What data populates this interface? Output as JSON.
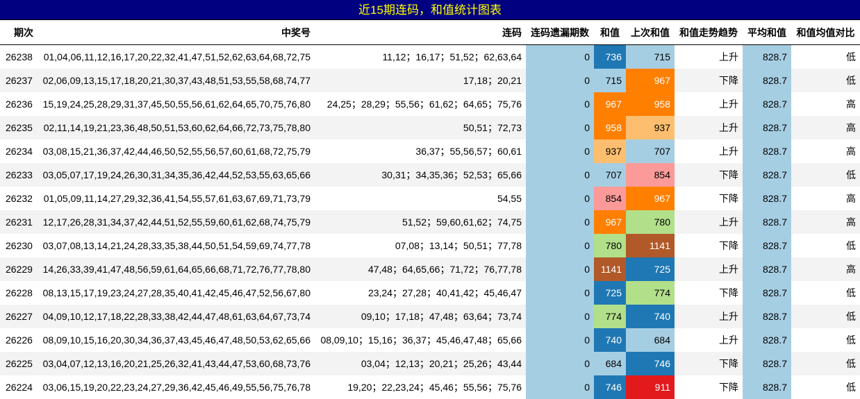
{
  "title": "近15期连码，和值统计图表",
  "headers": {
    "period": "期次",
    "nums": "中奖号",
    "lian": "连码",
    "miss": "连码遗漏期数",
    "sum": "和值",
    "prev_sum": "上次和值",
    "trend": "和值走势趋势",
    "avg": "平均和值",
    "cmp": "和值均值对比"
  },
  "colors": {
    "title_bg": "#010080",
    "title_text": "#ffff00",
    "sky": "#a6cee3",
    "blue": "#1f78b4",
    "lightblue": "#a6cee3",
    "orange": "#ff7f00",
    "lightorange": "#fdbf6f",
    "pink": "#fb9a99",
    "green": "#b2df8a",
    "brown": "#b15928",
    "red": "#e31a1c"
  },
  "rows": [
    {
      "period": "26238",
      "nums": "01,04,06,11,12,16,17,20,22,32,41,47,51,52,62,63,64,68,72,75",
      "lian": "11,12；16,17；51,52；62,63,64",
      "miss": "0",
      "sum": "736",
      "sum_color": "blue",
      "prev": "715",
      "prev_color": "lightblue",
      "trend": "上升",
      "avg": "828.7",
      "cmp": "低"
    },
    {
      "period": "26237",
      "nums": "02,06,09,13,15,17,18,20,21,30,37,43,48,51,53,55,58,68,74,77",
      "lian": "17,18；20,21",
      "miss": "0",
      "sum": "715",
      "sum_color": "lightblue",
      "prev": "967",
      "prev_color": "orange",
      "trend": "下降",
      "avg": "828.7",
      "cmp": "低"
    },
    {
      "period": "26236",
      "nums": "15,19,24,25,28,29,31,37,45,50,55,56,61,62,64,65,70,75,76,80",
      "lian": "24,25；28,29；55,56；61,62；64,65；75,76",
      "miss": "0",
      "sum": "967",
      "sum_color": "orange",
      "prev": "958",
      "prev_color": "orange",
      "trend": "上升",
      "avg": "828.7",
      "cmp": "高"
    },
    {
      "period": "26235",
      "nums": "02,11,14,19,21,23,36,48,50,51,53,60,62,64,66,72,73,75,78,80",
      "lian": "50,51；72,73",
      "miss": "0",
      "sum": "958",
      "sum_color": "orange",
      "prev": "937",
      "prev_color": "lightorange",
      "trend": "上升",
      "avg": "828.7",
      "cmp": "高"
    },
    {
      "period": "26234",
      "nums": "03,08,15,21,36,37,42,44,46,50,52,55,56,57,60,61,68,72,75,79",
      "lian": "36,37；55,56,57；60,61",
      "miss": "0",
      "sum": "937",
      "sum_color": "lightorange",
      "prev": "707",
      "prev_color": "lightblue",
      "trend": "上升",
      "avg": "828.7",
      "cmp": "高"
    },
    {
      "period": "26233",
      "nums": "03,05,07,17,19,24,26,30,31,34,35,36,42,44,52,53,55,63,65,66",
      "lian": "30,31；34,35,36；52,53；65,66",
      "miss": "0",
      "sum": "707",
      "sum_color": "lightblue",
      "prev": "854",
      "prev_color": "pink",
      "trend": "下降",
      "avg": "828.7",
      "cmp": "低"
    },
    {
      "period": "26232",
      "nums": "01,05,09,11,14,27,29,32,36,41,54,55,57,61,63,67,69,71,73,79",
      "lian": "54,55",
      "miss": "0",
      "sum": "854",
      "sum_color": "pink",
      "prev": "967",
      "prev_color": "orange",
      "trend": "下降",
      "avg": "828.7",
      "cmp": "高"
    },
    {
      "period": "26231",
      "nums": "12,17,26,28,31,34,37,42,44,51,52,55,59,60,61,62,68,74,75,79",
      "lian": "51,52；59,60,61,62；74,75",
      "miss": "0",
      "sum": "967",
      "sum_color": "orange",
      "prev": "780",
      "prev_color": "green",
      "trend": "上升",
      "avg": "828.7",
      "cmp": "高"
    },
    {
      "period": "26230",
      "nums": "03,07,08,13,14,21,24,28,33,35,38,44,50,51,54,59,69,74,77,78",
      "lian": "07,08；13,14；50,51；77,78",
      "miss": "0",
      "sum": "780",
      "sum_color": "green",
      "prev": "1141",
      "prev_color": "brown",
      "trend": "下降",
      "avg": "828.7",
      "cmp": "低"
    },
    {
      "period": "26229",
      "nums": "14,26,33,39,41,47,48,56,59,61,64,65,66,68,71,72,76,77,78,80",
      "lian": "47,48；64,65,66；71,72；76,77,78",
      "miss": "0",
      "sum": "1141",
      "sum_color": "brown",
      "prev": "725",
      "prev_color": "blue",
      "trend": "上升",
      "avg": "828.7",
      "cmp": "高"
    },
    {
      "period": "26228",
      "nums": "08,13,15,17,19,23,24,27,28,35,40,41,42,45,46,47,52,56,67,80",
      "lian": "23,24；27,28；40,41,42；45,46,47",
      "miss": "0",
      "sum": "725",
      "sum_color": "blue",
      "prev": "774",
      "prev_color": "green",
      "trend": "下降",
      "avg": "828.7",
      "cmp": "低"
    },
    {
      "period": "26227",
      "nums": "04,09,10,12,17,18,22,28,33,38,42,44,47,48,61,63,64,67,73,74",
      "lian": "09,10；17,18；47,48；63,64；73,74",
      "miss": "0",
      "sum": "774",
      "sum_color": "green",
      "prev": "740",
      "prev_color": "blue",
      "trend": "上升",
      "avg": "828.7",
      "cmp": "低"
    },
    {
      "period": "26226",
      "nums": "08,09,10,15,16,20,30,34,36,37,43,45,46,47,48,50,53,62,65,66",
      "lian": "08,09,10；15,16；36,37；45,46,47,48；65,66",
      "miss": "0",
      "sum": "740",
      "sum_color": "blue",
      "prev": "684",
      "prev_color": "lightblue",
      "trend": "上升",
      "avg": "828.7",
      "cmp": "低"
    },
    {
      "period": "26225",
      "nums": "03,04,07,12,13,16,20,21,25,26,32,41,43,44,47,53,60,68,73,76",
      "lian": "03,04；12,13；20,21；25,26；43,44",
      "miss": "0",
      "sum": "684",
      "sum_color": "lightblue",
      "prev": "746",
      "prev_color": "blue",
      "trend": "下降",
      "avg": "828.7",
      "cmp": "低"
    },
    {
      "period": "26224",
      "nums": "03,06,15,19,20,22,23,24,27,29,36,42,45,46,49,55,56,75,76,78",
      "lian": "19,20；22,23,24；45,46；55,56；75,76",
      "miss": "0",
      "sum": "746",
      "sum_color": "blue",
      "prev": "911",
      "prev_color": "red",
      "trend": "下降",
      "avg": "828.7",
      "cmp": "低"
    }
  ]
}
